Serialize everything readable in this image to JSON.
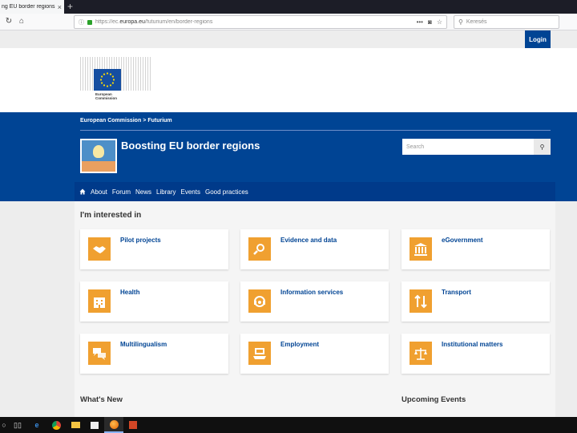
{
  "browser": {
    "tab_title": "ng EU border regions | F",
    "tab_close": "×",
    "new_tab": "+",
    "url_prefix": "https://ec.",
    "url_domain": "europa.eu",
    "url_suffix": "/futurium/en/border-regions",
    "url_more": "•••",
    "search_placeholder": "Keresés"
  },
  "site": {
    "login_label": "Login",
    "logo_line1": "European",
    "logo_line2": "Commission",
    "breadcrumb": [
      "European Commission",
      "Futurium"
    ],
    "breadcrumb_sep": ">",
    "title": "Boosting EU border regions",
    "search_placeholder": "Search",
    "menu": [
      "About",
      "Forum",
      "News",
      "Library",
      "Events",
      "Good practices"
    ]
  },
  "interests": {
    "heading": "I'm interested in",
    "cards": [
      {
        "label": "Pilot projects",
        "icon": "handshake-icon"
      },
      {
        "label": "Evidence and data",
        "icon": "magnifier-icon"
      },
      {
        "label": "eGovernment",
        "icon": "building-icon"
      },
      {
        "label": "Health",
        "icon": "hospital-icon"
      },
      {
        "label": "Information services",
        "icon": "headset-icon"
      },
      {
        "label": "Transport",
        "icon": "arrows-icon"
      },
      {
        "label": "Multilingualism",
        "icon": "speech-bubbles-icon"
      },
      {
        "label": "Employment",
        "icon": "laptop-hand-icon"
      },
      {
        "label": "Institutional matters",
        "icon": "scales-icon"
      }
    ]
  },
  "sections": {
    "whats_new": "What's New",
    "upcoming_events": "Upcoming Events"
  },
  "colors": {
    "brand_blue": "#004494",
    "accent_orange": "#f0a030"
  }
}
